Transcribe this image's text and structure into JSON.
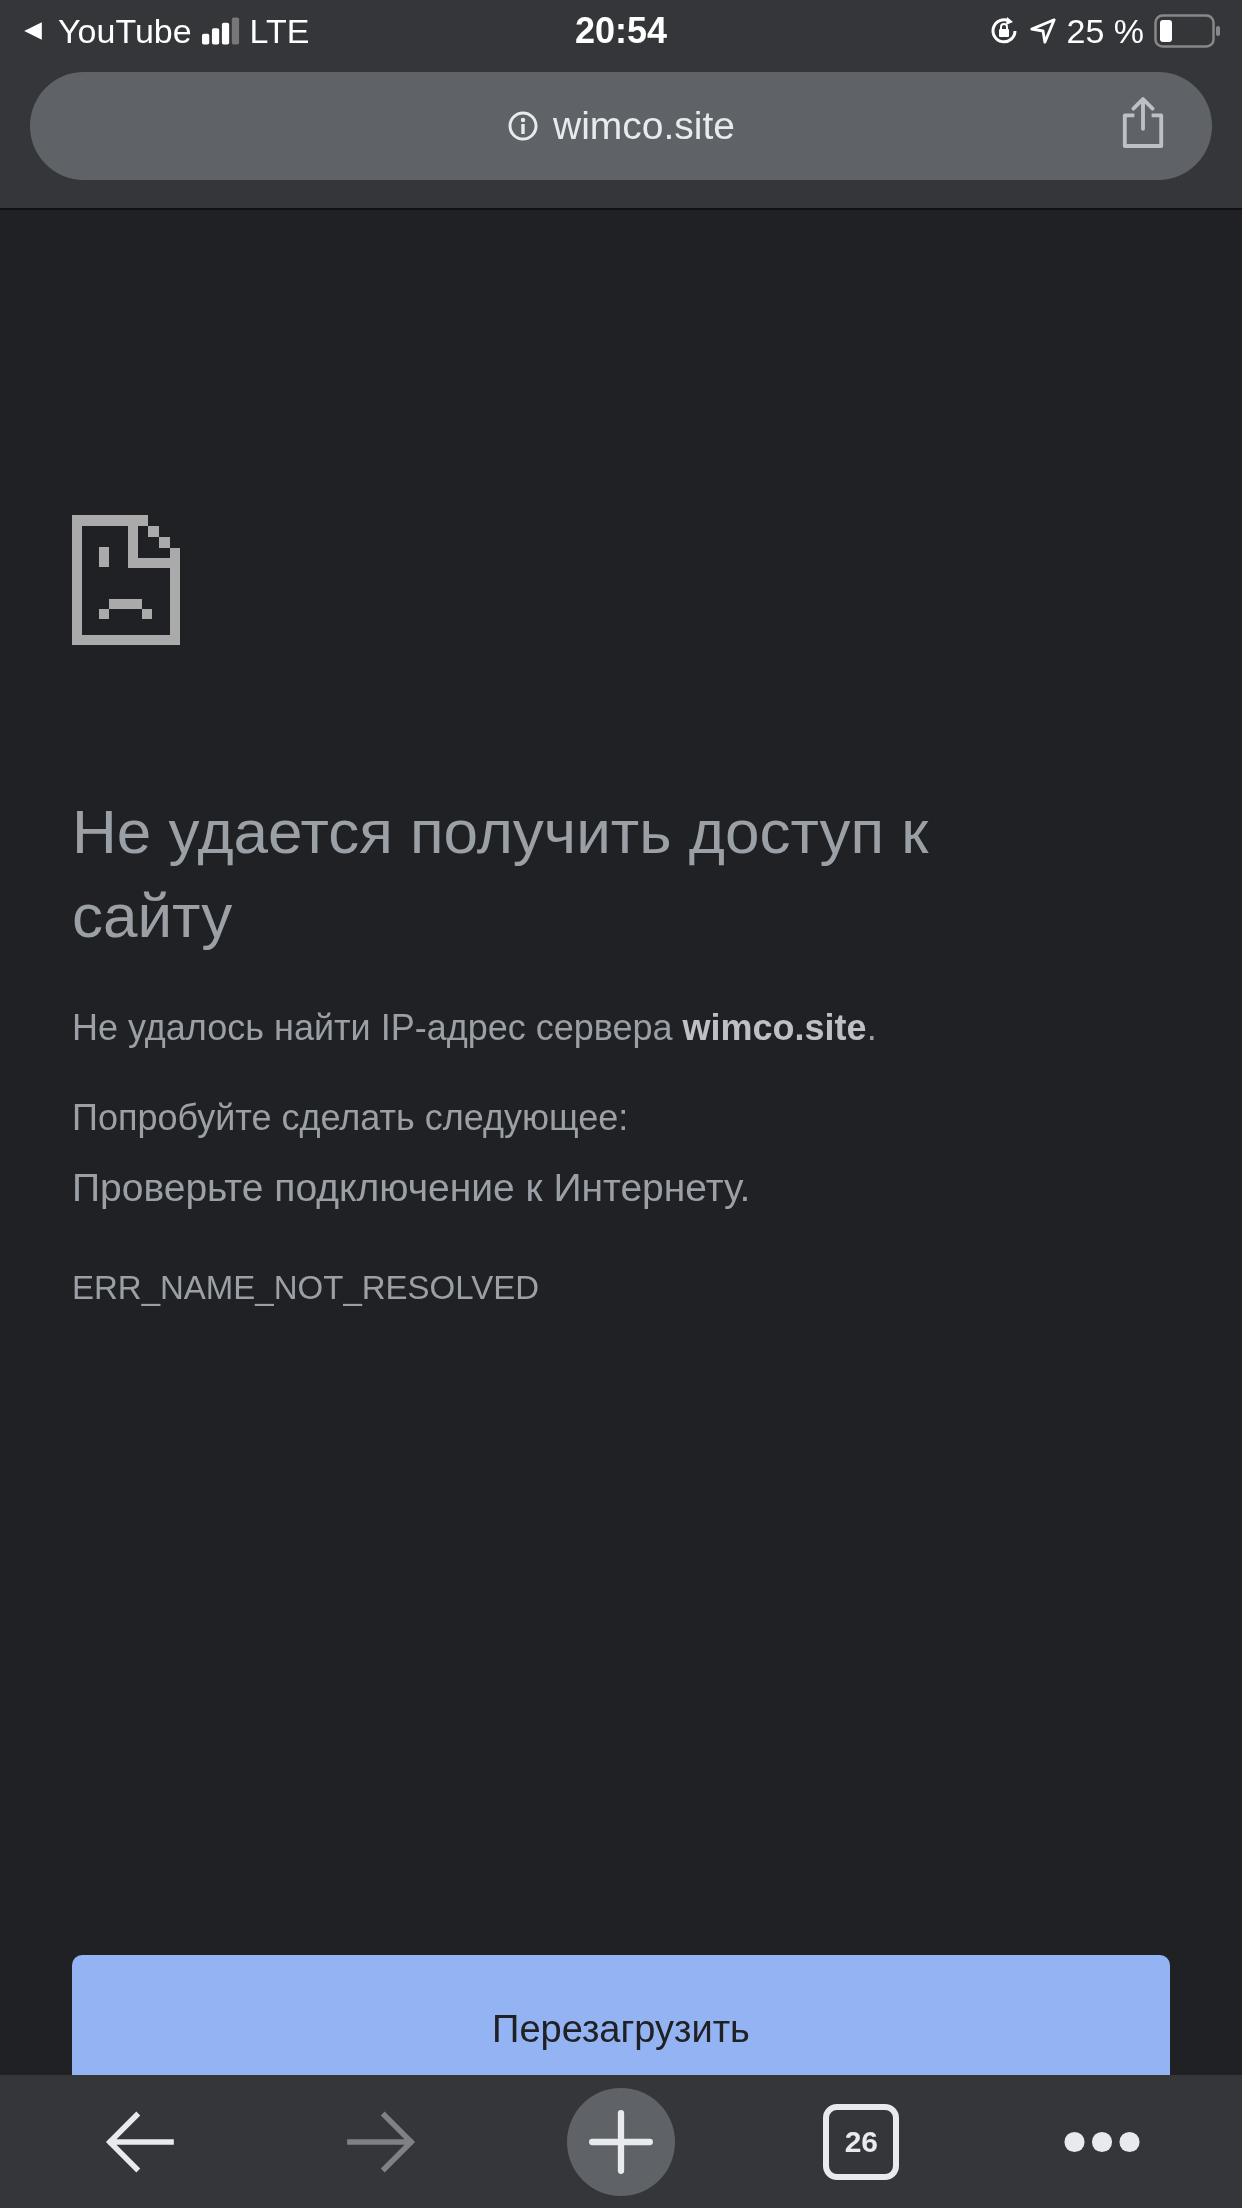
{
  "status_bar": {
    "back_app": "YouTube",
    "network": "LTE",
    "time": "20:54",
    "battery": "25 %"
  },
  "address_bar": {
    "url": "wimco.site"
  },
  "error_page": {
    "title": "Не удается получить доступ к сайту",
    "message": "Не удалось найти IP-адрес сервера **wimco.site**.",
    "suggestion_heading": "Попробуйте сделать следующее:",
    "suggestions": [
      "Проверьте подключение к Интернету."
    ],
    "error_code": "ERR_NAME_NOT_RESOLVED",
    "reload_button": "Перезагрузить"
  },
  "toolbar": [
    {
      "kind": "back",
      "disabled": false
    },
    {
      "kind": "forward",
      "disabled": true
    },
    {
      "kind": "new-tab",
      "disabled": false
    },
    {
      "kind": "tabs",
      "count": "26",
      "disabled": false
    },
    {
      "kind": "menu",
      "disabled": false
    }
  ]
}
